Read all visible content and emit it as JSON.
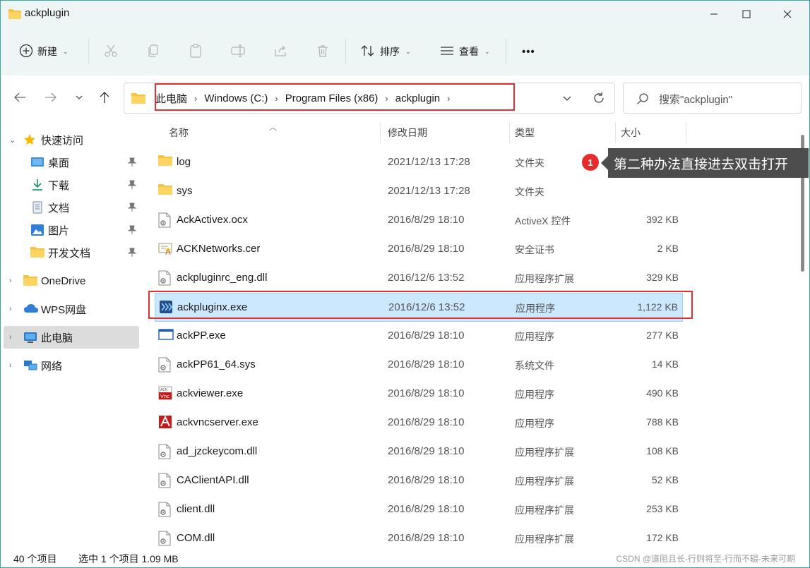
{
  "window": {
    "title": "ackplugin"
  },
  "toolbar": {
    "new_label": "新建",
    "sort_label": "排序",
    "view_label": "查看",
    "more_label": "•••"
  },
  "address": {
    "crumbs": [
      "此电脑",
      "Windows (C:)",
      "Program Files (x86)",
      "ackplugin"
    ],
    "search_placeholder": "搜索\"ackplugin\""
  },
  "sidebar": {
    "quick_access": "快速访问",
    "items": [
      {
        "label": "桌面",
        "icon": "desktop-icon"
      },
      {
        "label": "下载",
        "icon": "download-icon"
      },
      {
        "label": "文档",
        "icon": "document-icon"
      },
      {
        "label": "图片",
        "icon": "pictures-icon"
      },
      {
        "label": "开发文档",
        "icon": "folder-icon"
      }
    ],
    "onedrive": "OneDrive",
    "wps": "WPS网盘",
    "this_pc": "此电脑",
    "network": "网络"
  },
  "columns": {
    "name": "名称",
    "date": "修改日期",
    "type": "类型",
    "size": "大小"
  },
  "files": [
    {
      "name": "log",
      "date": "2021/12/13 17:28",
      "type": "文件夹",
      "size": "",
      "icon": "folder-icon"
    },
    {
      "name": "sys",
      "date": "2021/12/13 17:28",
      "type": "文件夹",
      "size": "",
      "icon": "folder-icon"
    },
    {
      "name": "AckActivex.ocx",
      "date": "2016/8/29 18:10",
      "type": "ActiveX 控件",
      "size": "392 KB",
      "icon": "file-gear-icon"
    },
    {
      "name": "ACKNetworks.cer",
      "date": "2016/8/29 18:10",
      "type": "安全证书",
      "size": "2 KB",
      "icon": "certificate-icon"
    },
    {
      "name": "ackpluginrc_eng.dll",
      "date": "2016/12/6 13:52",
      "type": "应用程序扩展",
      "size": "329 KB",
      "icon": "file-gear-icon"
    },
    {
      "name": "ackpluginx.exe",
      "date": "2016/12/6 13:52",
      "type": "应用程序",
      "size": "1,122 KB",
      "icon": "ackplugin-app-icon"
    },
    {
      "name": "ackPP.exe",
      "date": "2016/8/29 18:10",
      "type": "应用程序",
      "size": "277 KB",
      "icon": "window-app-icon"
    },
    {
      "name": "ackPP61_64.sys",
      "date": "2016/8/29 18:10",
      "type": "系统文件",
      "size": "14 KB",
      "icon": "file-gear-icon"
    },
    {
      "name": "ackviewer.exe",
      "date": "2016/8/29 18:10",
      "type": "应用程序",
      "size": "490 KB",
      "icon": "vnc-app-icon"
    },
    {
      "name": "ackvncserver.exe",
      "date": "2016/8/29 18:10",
      "type": "应用程序",
      "size": "788 KB",
      "icon": "vnc-server-icon"
    },
    {
      "name": "ad_jzckeycom.dll",
      "date": "2016/8/29 18:10",
      "type": "应用程序扩展",
      "size": "108 KB",
      "icon": "file-gear-icon"
    },
    {
      "name": "CAClientAPI.dll",
      "date": "2016/8/29 18:10",
      "type": "应用程序扩展",
      "size": "52 KB",
      "icon": "file-gear-icon"
    },
    {
      "name": "client.dll",
      "date": "2016/8/29 18:10",
      "type": "应用程序扩展",
      "size": "253 KB",
      "icon": "file-gear-icon"
    },
    {
      "name": "COM.dll",
      "date": "2016/8/29 18:10",
      "type": "应用程序扩展",
      "size": "172 KB",
      "icon": "file-gear-icon"
    }
  ],
  "selected_index": 5,
  "status": {
    "count": "40 个项目",
    "selection": "选中 1 个项目  1.09 MB"
  },
  "annotation": {
    "badge": "1",
    "callout": "第二种办法直接进去双击打开"
  },
  "watermark": "CSDN @道阻且长-行则将至-行而不辍-未来可期",
  "colors": {
    "accent": "#3aa9a0",
    "highlight": "#e03030",
    "selection": "#cce8ff"
  }
}
